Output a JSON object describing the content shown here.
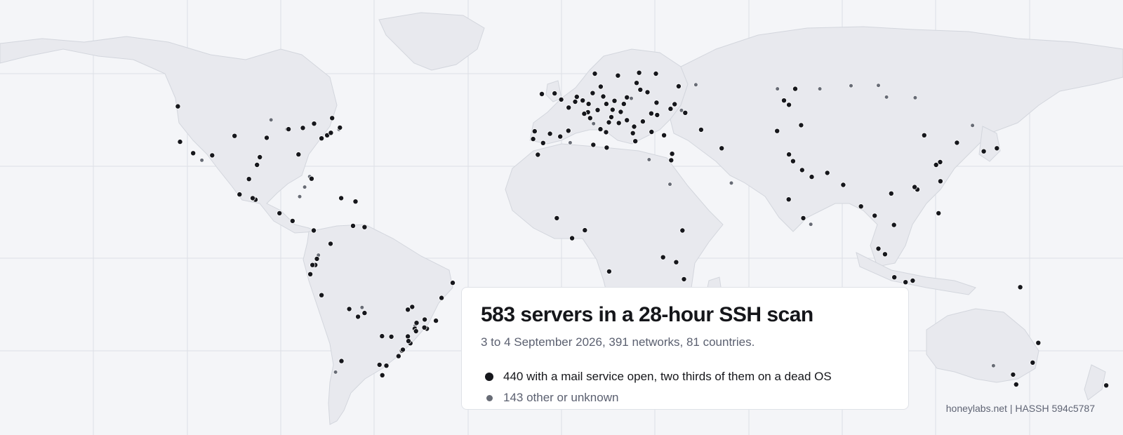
{
  "colors": {
    "mail": "#16171c",
    "other": "#676b75",
    "background": "#f4f5f8",
    "land": "#e8e9ee"
  },
  "title": "583 servers in a 28-hour SSH scan",
  "subtitle": "3 to 4 September 2026, 391 networks, 81 countries.",
  "legend": {
    "mail": "440 with a mail service open, two thirds of them on a dead OS",
    "other": "143 other or unknown"
  },
  "credit": "honeylabs.net | HASSH 594c5787",
  "markers": {
    "mail": [
      [
        -123.1,
        49.3
      ],
      [
        -122.4,
        37.8
      ],
      [
        -118.2,
        34.1
      ],
      [
        -112.1,
        33.4
      ],
      [
        -104.9,
        39.7
      ],
      [
        -97.7,
        30.3
      ],
      [
        -96.8,
        32.8
      ],
      [
        -94.6,
        39.1
      ],
      [
        -87.6,
        41.9
      ],
      [
        -84.4,
        33.7
      ],
      [
        -83.0,
        42.3
      ],
      [
        -80.2,
        25.8
      ],
      [
        -79.4,
        43.7
      ],
      [
        -77.0,
        38.9
      ],
      [
        -75.2,
        39.9
      ],
      [
        -74.0,
        40.7
      ],
      [
        -73.6,
        45.5
      ],
      [
        -71.1,
        42.4
      ],
      [
        -103.3,
        20.7
      ],
      [
        -99.1,
        19.4
      ],
      [
        -100.3,
        25.7
      ],
      [
        -98.2,
        19.0
      ],
      [
        -90.5,
        14.6
      ],
      [
        -86.3,
        12.1
      ],
      [
        -79.5,
        9.0
      ],
      [
        -70.7,
        19.5
      ],
      [
        -66.1,
        18.4
      ],
      [
        -74.1,
        4.7
      ],
      [
        -66.9,
        10.5
      ],
      [
        -63.2,
        10.1
      ],
      [
        -78.5,
        -0.2
      ],
      [
        -79.0,
        -2.2
      ],
      [
        -79.9,
        -2.2
      ],
      [
        -80.6,
        -5.2
      ],
      [
        -77.0,
        -12.0
      ],
      [
        -68.1,
        -16.5
      ],
      [
        -65.3,
        -19.0
      ],
      [
        -63.2,
        -17.8
      ],
      [
        -70.6,
        -33.4
      ],
      [
        -58.4,
        -34.6
      ],
      [
        -57.5,
        -38.0
      ],
      [
        -56.2,
        -34.9
      ],
      [
        -57.6,
        -25.3
      ],
      [
        -51.2,
        -30.0
      ],
      [
        -49.3,
        -25.4
      ],
      [
        -47.9,
        -15.8
      ],
      [
        -46.6,
        -23.5
      ],
      [
        -43.9,
        -19.9
      ],
      [
        -43.2,
        -22.9
      ],
      [
        -38.5,
        -12.9
      ],
      [
        -34.9,
        -8.0
      ],
      [
        -49.3,
        -16.7
      ],
      [
        -54.6,
        -25.5
      ],
      [
        -48.5,
        -27.6
      ],
      [
        -50.9,
        -29.7
      ],
      [
        -52.3,
        -31.8
      ],
      [
        -44.0,
        -22.5
      ],
      [
        -47.1,
        -22.9
      ],
      [
        -40.3,
        -20.3
      ],
      [
        -46.5,
        -21.0
      ],
      [
        -3.7,
        40.4
      ],
      [
        -9.1,
        38.7
      ],
      [
        -8.6,
        41.2
      ],
      [
        2.2,
        41.4
      ],
      [
        -0.4,
        39.5
      ],
      [
        -5.9,
        37.4
      ],
      [
        -6.3,
        53.3
      ],
      [
        -0.1,
        51.5
      ],
      [
        -2.2,
        53.5
      ],
      [
        2.3,
        48.9
      ],
      [
        4.9,
        52.4
      ],
      [
        4.4,
        50.8
      ],
      [
        6.8,
        51.2
      ],
      [
        8.7,
        50.1
      ],
      [
        11.6,
        48.1
      ],
      [
        13.4,
        52.5
      ],
      [
        10.0,
        53.6
      ],
      [
        8.5,
        47.4
      ],
      [
        7.3,
        46.9
      ],
      [
        9.2,
        45.5
      ],
      [
        12.5,
        41.9
      ],
      [
        14.3,
        40.9
      ],
      [
        16.4,
        48.2
      ],
      [
        14.4,
        50.1
      ],
      [
        19.0,
        47.5
      ],
      [
        21.0,
        52.2
      ],
      [
        17.0,
        51.1
      ],
      [
        20.0,
        50.1
      ],
      [
        18.1,
        59.3
      ],
      [
        10.7,
        59.9
      ],
      [
        12.6,
        55.7
      ],
      [
        24.9,
        60.2
      ],
      [
        24.1,
        56.9
      ],
      [
        25.3,
        54.7
      ],
      [
        26.1,
        44.4
      ],
      [
        23.3,
        42.7
      ],
      [
        21.0,
        44.8
      ],
      [
        16.0,
        45.8
      ],
      [
        15.2,
        44.1
      ],
      [
        18.4,
        43.9
      ],
      [
        23.7,
        38.0
      ],
      [
        22.9,
        40.6
      ],
      [
        30.5,
        50.5
      ],
      [
        27.6,
        53.9
      ],
      [
        28.9,
        41.0
      ],
      [
        32.9,
        39.9
      ],
      [
        36.3,
        50.0
      ],
      [
        35.0,
        48.5
      ],
      [
        30.7,
        46.5
      ],
      [
        28.8,
        47.0
      ],
      [
        37.6,
        55.8
      ],
      [
        30.3,
        59.9
      ],
      [
        39.7,
        47.2
      ],
      [
        44.8,
        41.7
      ],
      [
        35.2,
        31.8
      ],
      [
        35.5,
        33.9
      ],
      [
        51.4,
        35.7
      ],
      [
        3.4,
        6.5
      ],
      [
        7.5,
        9.1
      ],
      [
        36.8,
        -1.3
      ],
      [
        32.6,
        0.3
      ],
      [
        39.3,
        -6.8
      ],
      [
        38.8,
        9.0
      ],
      [
        15.3,
        -4.3
      ],
      [
        69.2,
        41.3
      ],
      [
        76.9,
        43.2
      ],
      [
        73.0,
        49.8
      ],
      [
        71.4,
        51.2
      ],
      [
        75.0,
        55.0
      ],
      [
        72.9,
        19.1
      ],
      [
        77.2,
        28.6
      ],
      [
        77.6,
        13.0
      ],
      [
        85.3,
        27.7
      ],
      [
        73.0,
        33.7
      ],
      [
        74.3,
        31.5
      ],
      [
        80.3,
        26.4
      ],
      [
        90.4,
        23.8
      ],
      [
        96.1,
        16.8
      ],
      [
        100.5,
        13.8
      ],
      [
        101.7,
        3.1
      ],
      [
        103.8,
        1.3
      ],
      [
        106.8,
        -6.2
      ],
      [
        110.4,
        -7.8
      ],
      [
        112.7,
        -7.3
      ],
      [
        105.8,
        21.0
      ],
      [
        106.7,
        10.8
      ],
      [
        121.0,
        14.6
      ],
      [
        114.2,
        22.3
      ],
      [
        113.3,
        23.1
      ],
      [
        116.4,
        39.9
      ],
      [
        121.5,
        31.2
      ],
      [
        120.2,
        30.3
      ],
      [
        121.6,
        25.0
      ],
      [
        126.9,
        37.5
      ],
      [
        135.5,
        34.7
      ],
      [
        139.7,
        35.7
      ],
      [
        144.9,
        -37.8
      ],
      [
        145.9,
        -41.0
      ],
      [
        151.2,
        -33.9
      ],
      [
        174.8,
        -41.3
      ],
      [
        153.0,
        -27.5
      ],
      [
        147.2,
        -9.4
      ],
      [
        -99.1,
        19.5
      ],
      [
        -46.7,
        -23.7
      ],
      [
        -49.1,
        -26.9
      ],
      [
        14.5,
        35.9
      ],
      [
        10.2,
        36.8
      ],
      [
        -7.6,
        33.6
      ],
      [
        -1.5,
        13.0
      ]
    ],
    "other": [
      [
        -84.0,
        20.0
      ],
      [
        -82.4,
        23.1
      ],
      [
        -80.8,
        26.5
      ],
      [
        -88.1,
        41.9
      ],
      [
        -93.2,
        44.9
      ],
      [
        -71.4,
        41.8
      ],
      [
        -72.5,
        -37.0
      ],
      [
        34.8,
        24.0
      ],
      [
        38.5,
        48.0
      ],
      [
        43.1,
        56.3
      ],
      [
        54.5,
        24.4
      ],
      [
        69.3,
        55.0
      ],
      [
        82.9,
        55.0
      ],
      [
        92.9,
        56.0
      ],
      [
        101.7,
        56.1
      ],
      [
        104.3,
        52.3
      ],
      [
        113.5,
        52.1
      ],
      [
        116.2,
        39.6
      ],
      [
        131.9,
        43.1
      ],
      [
        138.6,
        -34.9
      ],
      [
        22.4,
        51.9
      ],
      [
        80.0,
        11.0
      ],
      [
        28.1,
        32.0
      ],
      [
        -78.0,
        1.0
      ],
      [
        10.3,
        43.7
      ],
      [
        -47.0,
        -22.0
      ],
      [
        2.8,
        37.5
      ],
      [
        -64.0,
        -16.0
      ],
      [
        -115.4,
        31.8
      ]
    ]
  }
}
